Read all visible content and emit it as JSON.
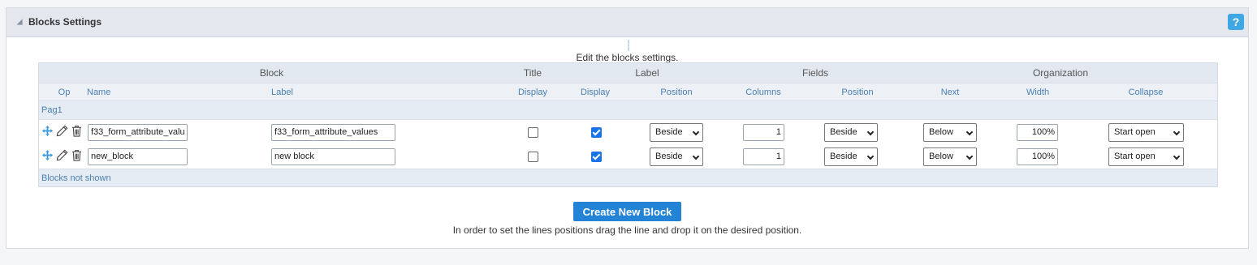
{
  "panel": {
    "title": "Blocks Settings",
    "help_label": "?"
  },
  "intro": "Edit the blocks settings.",
  "grid": {
    "group_headers": [
      "Block",
      "Title",
      "Label",
      "Fields",
      "Organization"
    ],
    "column_headers": [
      "Op",
      "Name",
      "Label",
      "Display",
      "Display",
      "Position",
      "Columns",
      "Position",
      "Next",
      "Width",
      "Collapse"
    ],
    "section": "Pag1",
    "rows": [
      {
        "name": "f33_form_attribute_valu",
        "label": "f33_form_attribute_values",
        "title_display": false,
        "label_display": true,
        "label_position": "Beside",
        "columns": "1",
        "fields_position": "Beside",
        "next": "Below",
        "width": "100%",
        "collapse": "Start open"
      },
      {
        "name": "new_block",
        "label": "new block",
        "title_display": false,
        "label_display": true,
        "label_position": "Beside",
        "columns": "1",
        "fields_position": "Beside",
        "next": "Below",
        "width": "100%",
        "collapse": "Start open"
      }
    ],
    "footer": "Blocks not shown"
  },
  "create_button": "Create New Block",
  "hint": "In order to set the lines positions drag the line and drop it on the desired position.",
  "colors": {
    "accent": "#2383d6",
    "help": "#3fa7e3",
    "header_bg": "#e4e8ee",
    "link": "#4a7fb0"
  },
  "icons": {
    "move": "move-arrows-icon",
    "edit": "pencil-icon",
    "delete": "trash-icon"
  }
}
